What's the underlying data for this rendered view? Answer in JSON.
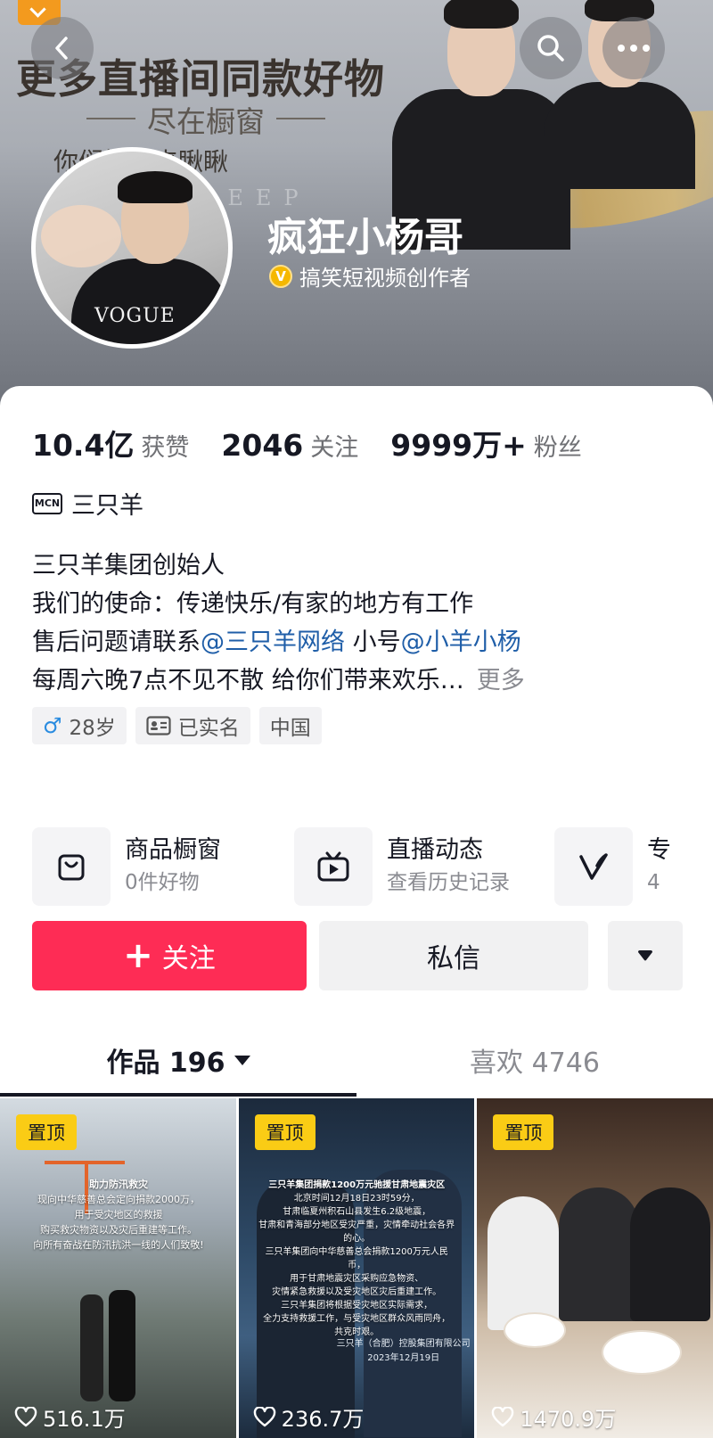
{
  "banner": {
    "headline": "更多直播间同款好物",
    "subheadline": "尽在橱窗",
    "tagline": "你们快进来瞅瞅",
    "watermark": "SHEEP"
  },
  "profile": {
    "nickname": "疯狂小杨哥",
    "verify_badge": "V",
    "verify_text": "搞笑短视频创作者",
    "avatar_text": "VOGUE"
  },
  "stats": [
    {
      "value": "10.4亿",
      "label": "获赞"
    },
    {
      "value": "2046",
      "label": "关注"
    },
    {
      "value": "9999万+",
      "label": "粉丝"
    }
  ],
  "mcn": {
    "logo": "MCN",
    "name": "三只羊"
  },
  "bio": {
    "line1": "三只羊集团创始人",
    "line2": "我们的使命：传递快乐/有家的地方有工作",
    "line3_prefix": "售后问题请联系",
    "line3_link1": "@三只羊网络",
    "line3_middle": " 小号",
    "line3_link2": "@小羊小杨",
    "line4": "每周六晚7点不见不散  给你们带来欢乐…",
    "more": "更多"
  },
  "tags": {
    "gender_symbol": "♂",
    "age": "28岁",
    "realname": "已实名",
    "region": "中国"
  },
  "features": [
    {
      "icon": "shopping-bag-icon",
      "title": "商品橱窗",
      "sub": "0件好物"
    },
    {
      "icon": "tv-live-icon",
      "title": "直播动态",
      "sub": "查看历史记录"
    },
    {
      "icon": "v-logo-icon",
      "title": "专",
      "sub": "4"
    }
  ],
  "actions": {
    "follow_plus": "+",
    "follow": "关注",
    "message": "私信"
  },
  "tabs": {
    "works": "作品 196",
    "likes": "喜欢 4746"
  },
  "videos": [
    {
      "pinned": "置顶",
      "likes": "516.1万",
      "caption_lines": [
        "助力防汛救灾",
        "现向中华慈善总会定向捐款2000万，",
        "用于受灾地区的救援",
        "购买救灾物资以及灾后重建等工作。",
        "向所有奋战在防汛抗洪一线的人们致敬!"
      ]
    },
    {
      "pinned": "置顶",
      "likes": "236.7万",
      "caption_lines": [
        "三只羊集团捐款1200万元驰援甘肃地震灾区",
        "北京时间12月18日23时59分，",
        "甘肃临夏州积石山县发生6.2级地震，",
        "甘肃和青海部分地区受灾严重，灾情牵动社会各界的心。",
        "三只羊集团向中华慈善总会捐款1200万元人民币，",
        "用于甘肃地震灾区采购应急物资、",
        "灾情紧急救援以及受灾地区灾后重建工作。",
        "三只羊集团将根据受灾地区实际需求，",
        "全力支持救援工作，与受灾地区群众风雨同舟，",
        "共克时艰。"
      ],
      "footer_lines": [
        "三只羊（合肥）控股集团有限公司",
        "2023年12月19日"
      ]
    },
    {
      "pinned": "置顶",
      "likes": "1470.9万",
      "caption_lines": []
    }
  ]
}
